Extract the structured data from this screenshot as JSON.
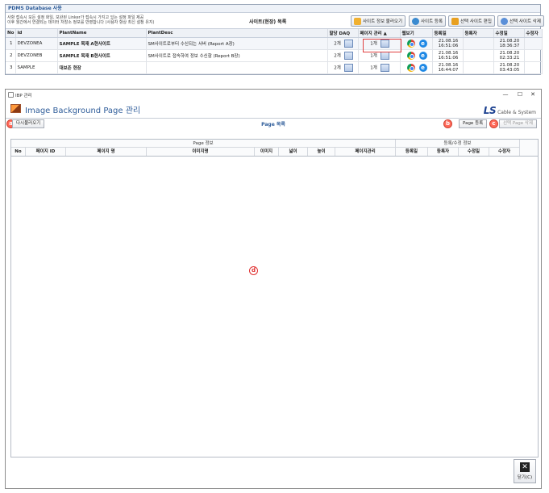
{
  "pdms": {
    "title": "PDMS Database 사용",
    "notice_lines": [
      "사항 접속시 모든 설정 화일, 보완된 Linker가 접속시 가지고 있는 설정 파일 제공",
      "이후 월간에서 연결되는 데이터 저장소 정보를 반영합니다 (사용자 항상 최신 설정 유지)"
    ],
    "list_title": "사이트(현장) 목록",
    "buttons": {
      "load_info": "사이트 정보 불러오기",
      "register": "사이트 등록",
      "edit": "선택 사이트 편집",
      "delete": "선택 사이트 삭제"
    },
    "columns": [
      "No",
      "id",
      "PlantName",
      "PlantDesc",
      "할당 DAQ",
      "페이지 관리 ▲",
      "웹보기",
      "등록일",
      "등록자",
      "수정일",
      "수정자"
    ],
    "rows": [
      {
        "no": "1",
        "id": "DEVZONEA",
        "name": "SAMPLE 목재 A현사이트",
        "desc": "SM사이트로부터 수신되는 서버 (Report A장)",
        "daq": "2개",
        "pages": "1개",
        "reg_date": "21.08.16",
        "reg_time": "16:51:06",
        "mod_date": "21.08.20",
        "mod_time": "18:36:37"
      },
      {
        "no": "2",
        "id": "DEVZONEB",
        "name": "SAMPLE 목재 B현사이트",
        "desc": "SM사이트로 접속하여 정보 수신함 (Report B장)",
        "daq": "2개",
        "pages": "1개",
        "reg_date": "21.08.16",
        "reg_time": "16:51:06",
        "mod_date": "21.08.20",
        "mod_time": "02:33:21"
      },
      {
        "no": "3",
        "id": "SAMPLE",
        "name": "대보존 현장",
        "desc": "",
        "daq": "2개",
        "pages": "1개",
        "reg_date": "21.08.16",
        "reg_time": "16:44:07",
        "mod_date": "21.08.20",
        "mod_time": "03:43:05"
      }
    ]
  },
  "window": {
    "title": "IBP 관리",
    "controls": {
      "minimize": "—",
      "maximize": "☐",
      "close": "✕"
    },
    "header_title": "Image Background Page 관리",
    "logo": {
      "ls": "LS",
      "company": "Cable & System"
    },
    "reload_button": "다시불러오기",
    "page_list_title": "Page 목록",
    "register_button": "Page 등록",
    "delete_button": "선택 Page 삭제",
    "callouts": {
      "a": "a",
      "b": "b",
      "c": "c",
      "d": "d"
    },
    "column_groups": {
      "page_info": "Page 정보",
      "reg_info": "등록/수정 정보"
    },
    "columns": [
      "No",
      "페이지 ID",
      "페이지 명",
      "이미지명",
      "이미지",
      "넓이",
      "높이",
      "페이지관리",
      "등록일",
      "등록자",
      "수정일",
      "수정자"
    ],
    "close_label": "닫기(C)",
    "close_glyph": "✕"
  },
  "colors": {
    "accent": "#2f5d9a",
    "callout": "#e03030",
    "logo": "#1a3f8f"
  }
}
